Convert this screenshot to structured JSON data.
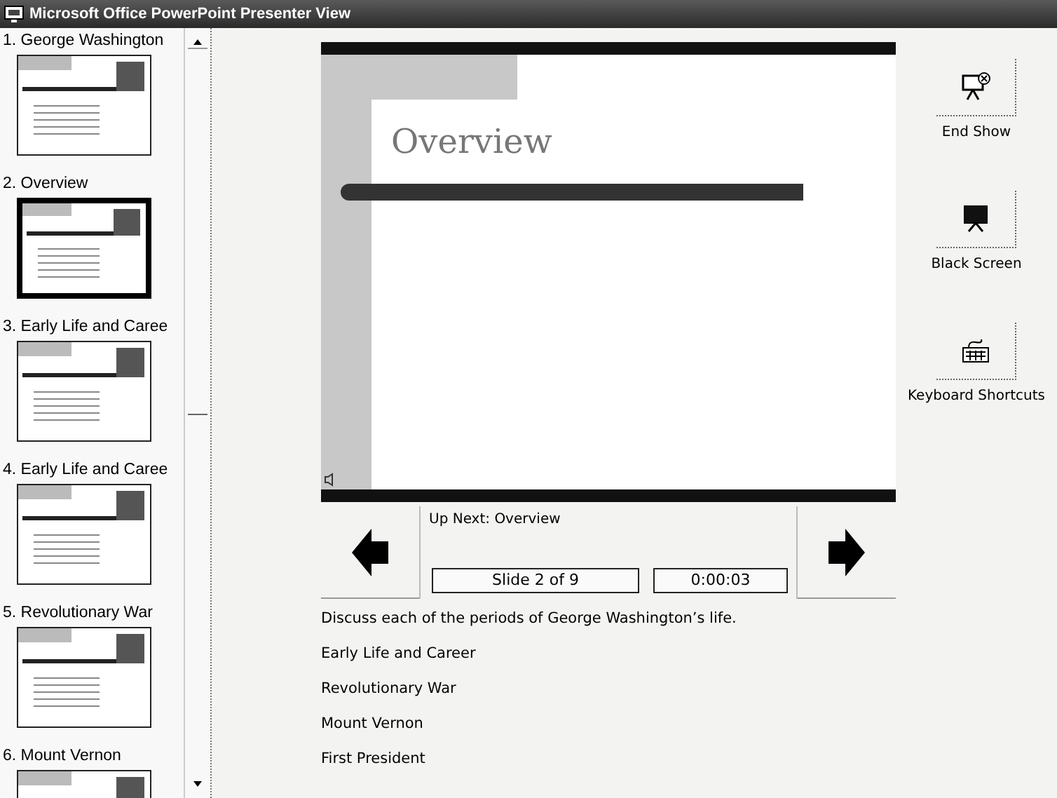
{
  "window": {
    "title": "Microsoft Office PowerPoint Presenter View"
  },
  "slides": [
    {
      "label": "1. George Washington",
      "selected": false
    },
    {
      "label": "2. Overview",
      "selected": true
    },
    {
      "label": "3. Early Life and Caree",
      "selected": false
    },
    {
      "label": "4. Early Life and Caree",
      "selected": false
    },
    {
      "label": "5. Revolutionary War",
      "selected": false
    },
    {
      "label": "6. Mount Vernon",
      "selected": false
    }
  ],
  "current_slide": {
    "title": "Overview"
  },
  "tools": [
    {
      "kind": "end",
      "label": "End Show"
    },
    {
      "kind": "black",
      "label": "Black Screen"
    },
    {
      "kind": "keyboard",
      "label": "Keyboard Shortcuts"
    }
  ],
  "navigation": {
    "up_next": "Up Next: Overview",
    "slide_counter": "Slide 2 of 9",
    "timer": "0:00:03"
  },
  "notes": [
    "Discuss each of the periods of George Washington’s life.",
    "Early Life and Career",
    "Revolutionary War",
    "Mount Vernon",
    "First President"
  ]
}
